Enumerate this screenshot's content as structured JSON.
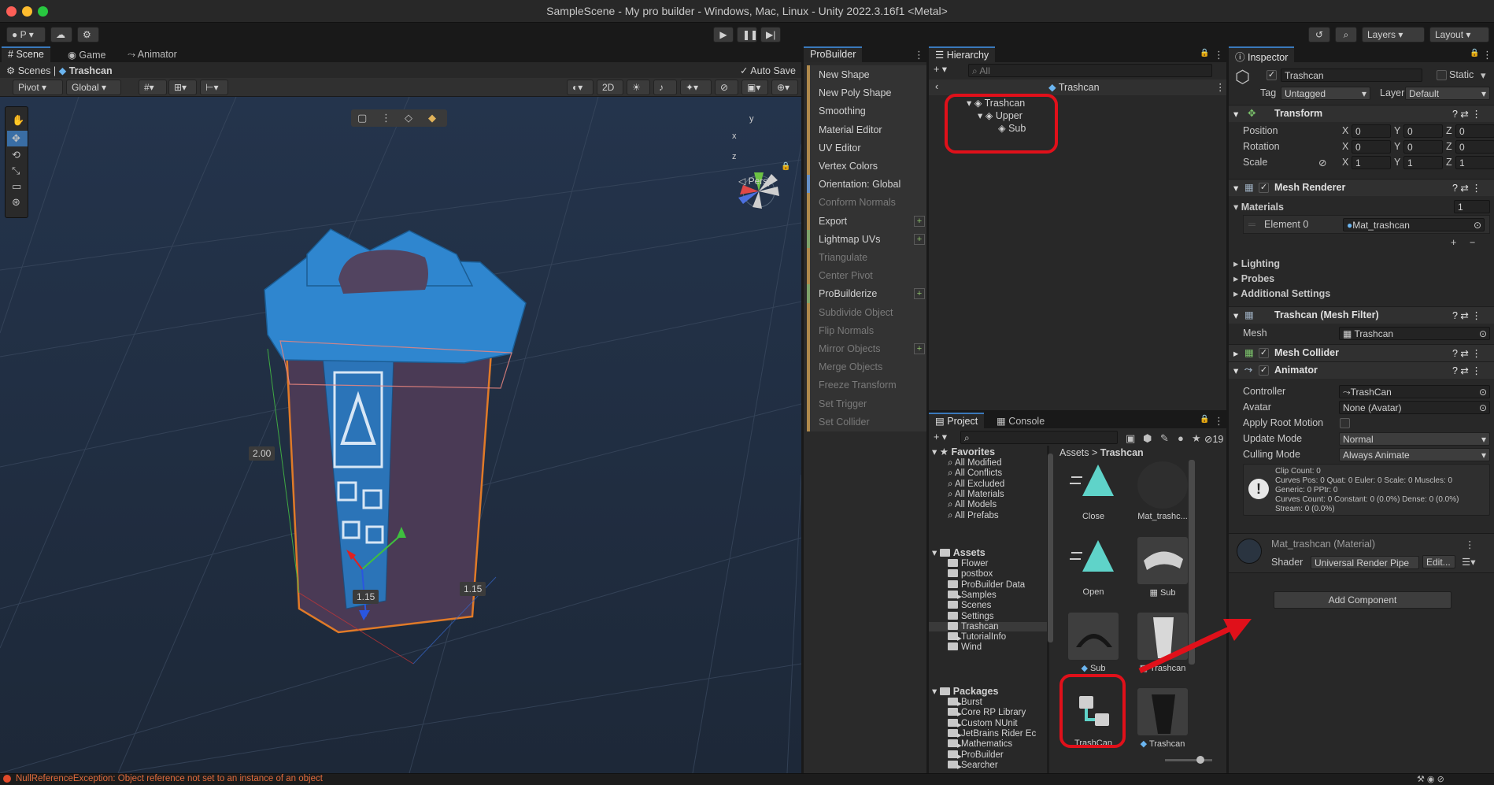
{
  "window": {
    "title": "SampleScene - My pro builder - Windows, Mac, Linux - Unity 2022.3.16f1 <Metal>"
  },
  "toolbar": {
    "account": "P",
    "layers": "Layers",
    "layout": "Layout"
  },
  "scene": {
    "tabs": [
      "Scene",
      "Game",
      "Animator"
    ],
    "breadcrumb_root": "Scenes",
    "breadcrumb_object": "Trashcan",
    "auto_save": "Auto Save",
    "pivot": "Pivot",
    "global": "Global",
    "mode_2d": "2D",
    "persp": "Persp",
    "dim_height": "2.00",
    "dim_depth": "1.15",
    "dim_width": "1.15",
    "gizmo_y": "y",
    "gizmo_x": "x",
    "gizmo_z": "z"
  },
  "probuilder": {
    "title": "ProBuilder",
    "items": [
      "New Shape",
      "New Poly Shape",
      "Smoothing",
      "Material Editor",
      "UV Editor",
      "Vertex Colors",
      "Orientation: Global",
      "Conform Normals",
      "Export",
      "Lightmap UVs",
      "Triangulate",
      "Center Pivot",
      "ProBuilderize",
      "Subdivide Object",
      "Flip Normals",
      "Mirror Objects",
      "Merge Objects",
      "Freeze Transform",
      "Set Trigger",
      "Set Collider"
    ]
  },
  "hierarchy": {
    "title": "Hierarchy",
    "search": "All",
    "scene_name": "Trashcan",
    "items": [
      "Trashcan",
      "Upper",
      "Sub"
    ]
  },
  "project": {
    "tabs": [
      "Project",
      "Console"
    ],
    "hidden_count": "19",
    "favorites_title": "Favorites",
    "favorites": [
      "All Modified",
      "All Conflicts",
      "All Excluded",
      "All Materials",
      "All Models",
      "All Prefabs"
    ],
    "assets_title": "Assets",
    "assets": [
      "Flower",
      "postbox",
      "ProBuilder Data",
      "Samples",
      "Scenes",
      "Settings",
      "Trashcan",
      "TutorialInfo",
      "Wind"
    ],
    "packages_title": "Packages",
    "packages": [
      "Burst",
      "Core RP Library",
      "Custom NUnit",
      "JetBrains Rider Ec",
      "Mathematics",
      "ProBuilder",
      "Searcher"
    ],
    "path_root": "Assets",
    "path_folder": "Trashcan",
    "grid": [
      "Close",
      "Mat_trashc...",
      "Open",
      "Sub",
      "Sub",
      "Trashcan",
      "TrashCan",
      "Trashcan"
    ]
  },
  "inspector": {
    "title": "Inspector",
    "object_name": "Trashcan",
    "static": "Static",
    "tag_label": "Tag",
    "tag_value": "Untagged",
    "layer_label": "Layer",
    "layer_value": "Default",
    "transform": "Transform",
    "position": "Position",
    "rotation": "Rotation",
    "scale": "Scale",
    "axis_x": "X",
    "axis_y": "Y",
    "axis_z": "Z",
    "pos": [
      "0",
      "0",
      "0"
    ],
    "rot": [
      "0",
      "0",
      "0"
    ],
    "scl": [
      "1",
      "1",
      "1"
    ],
    "mesh_renderer": "Mesh Renderer",
    "materials": "Materials",
    "materials_count": "1",
    "element0": "Element 0",
    "element0_value": "Mat_trashcan",
    "lighting": "Lighting",
    "probes": "Probes",
    "additional": "Additional Settings",
    "mesh_filter": "Trashcan (Mesh Filter)",
    "mesh_label": "Mesh",
    "mesh_value": "Trashcan",
    "mesh_collider": "Mesh Collider",
    "animator": "Animator",
    "controller_label": "Controller",
    "controller_value": "TrashCan",
    "avatar_label": "Avatar",
    "avatar_value": "None (Avatar)",
    "apply_root": "Apply Root Motion",
    "update_label": "Update Mode",
    "update_value": "Normal",
    "culling_label": "Culling Mode",
    "culling_value": "Always Animate",
    "info_lines": [
      "Clip Count: 0",
      "Curves Pos: 0 Quat: 0 Euler: 0 Scale: 0 Muscles: 0",
      "Generic: 0 PPtr: 0",
      "Curves Count: 0 Constant: 0 (0.0%) Dense: 0 (0.0%)",
      "Stream: 0 (0.0%)"
    ],
    "material_name": "Mat_trashcan (Material)",
    "shader_label": "Shader",
    "shader_value": "Universal Render Pipe",
    "edit": "Edit...",
    "add_component": "Add Component"
  },
  "status": {
    "message": "NullReferenceException: Object reference not set to an instance of an object"
  }
}
